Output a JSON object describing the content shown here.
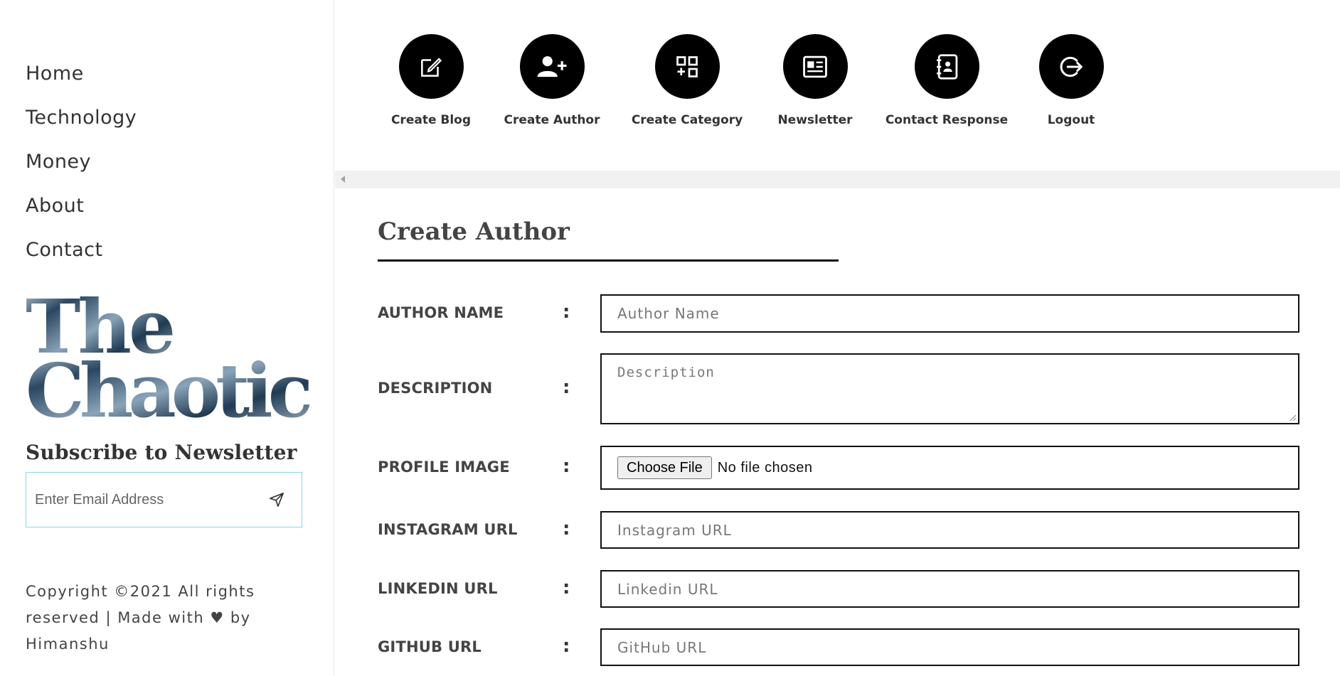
{
  "sidebar": {
    "nav_items": [
      {
        "label": "Home"
      },
      {
        "label": "Technology"
      },
      {
        "label": "Money"
      },
      {
        "label": "About"
      },
      {
        "label": "Contact"
      }
    ],
    "logo": {
      "line1": "The",
      "line2": "Chaotic"
    },
    "newsletter": {
      "title": "Subscribe to Newsletter",
      "email_placeholder": "Enter Email Address",
      "email_value": ""
    },
    "copyright": "Copyright ©2021 All rights reserved | Made with ♥ by Himanshu"
  },
  "toolbar": {
    "items": [
      {
        "label": "Create Blog",
        "icon": "edit-icon"
      },
      {
        "label": "Create Author",
        "icon": "user-plus-icon"
      },
      {
        "label": "Create Category",
        "icon": "category-icon"
      },
      {
        "label": "Newsletter",
        "icon": "newspaper-icon"
      },
      {
        "label": "Contact Response",
        "icon": "contact-book-icon"
      },
      {
        "label": "Logout",
        "icon": "logout-icon"
      }
    ]
  },
  "form": {
    "title": "Create Author",
    "fields": {
      "author_name": {
        "label": "AUTHOR NAME",
        "placeholder": "Author Name",
        "value": ""
      },
      "description": {
        "label": "DESCRIPTION",
        "placeholder": "Description",
        "value": ""
      },
      "profile_image": {
        "label": "PROFILE IMAGE",
        "button_label": "Choose File",
        "status": "No file chosen"
      },
      "instagram_url": {
        "label": "INSTAGRAM URL",
        "placeholder": "Instagram URL",
        "value": ""
      },
      "linkedin_url": {
        "label": "LINKEDIN URL",
        "placeholder": "Linkedin URL",
        "value": ""
      },
      "github_url": {
        "label": "GITHUB URL",
        "placeholder": "GitHub URL",
        "value": ""
      }
    },
    "separator": ":"
  },
  "colors": {
    "accent_border": "#8fd3e8",
    "icon_bg": "#000000",
    "logo_gradient": [
      "#1f3a52",
      "#6d8aa3",
      "#c9d6df"
    ]
  }
}
